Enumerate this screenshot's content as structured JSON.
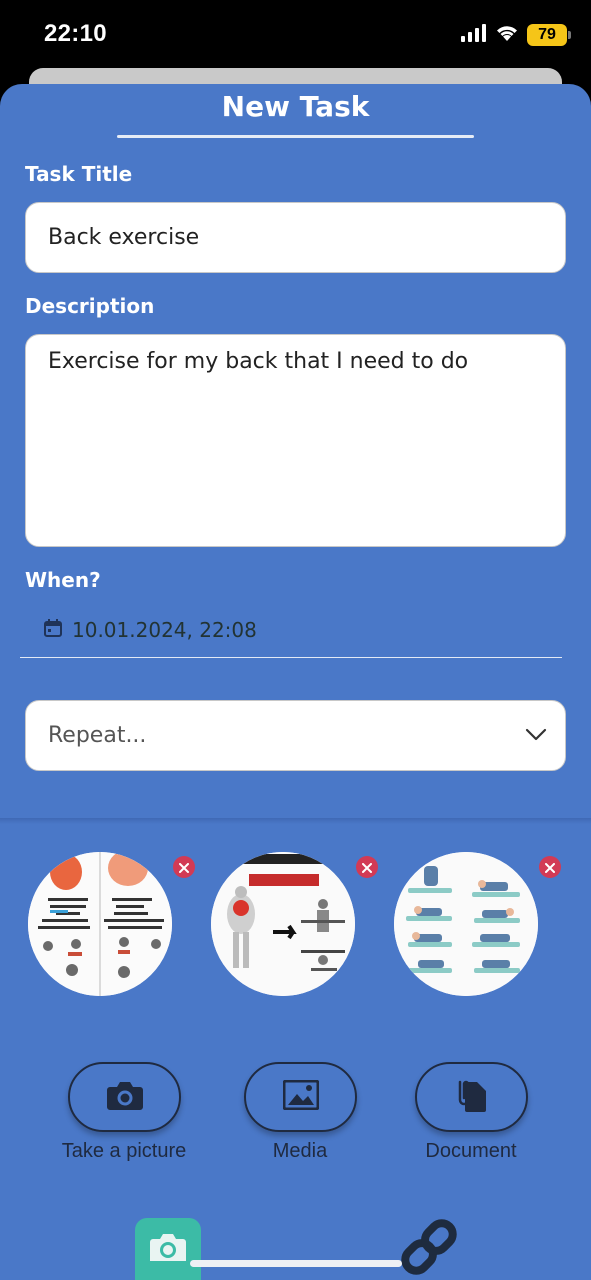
{
  "status_bar": {
    "time": "22:10",
    "battery": "79"
  },
  "header": {
    "title": "New Task"
  },
  "task_title": {
    "label": "Task Title",
    "value": "Back exercise"
  },
  "description": {
    "label": "Description",
    "value": "Exercise for my back that I need to do"
  },
  "when": {
    "label": "When?",
    "value": "10.01.2024, 22:08"
  },
  "repeat": {
    "placeholder": "Repeat..."
  },
  "attachments": [
    {
      "icon": "image-thumbnail"
    },
    {
      "icon": "image-thumbnail"
    },
    {
      "icon": "image-thumbnail"
    }
  ],
  "actions": {
    "take_picture": "Take a picture",
    "media": "Media",
    "document": "Document"
  },
  "colors": {
    "sheet_bg": "#4a78c8",
    "remove": "#d23a55",
    "camera_tab": "#3cbba6",
    "battery": "#f5c518"
  }
}
